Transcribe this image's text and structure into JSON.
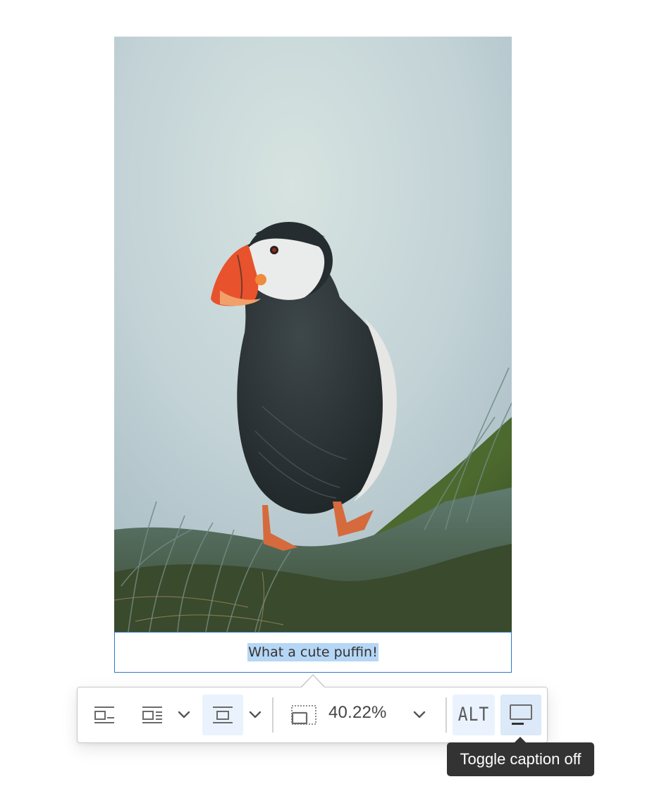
{
  "image": {
    "subject": "Puffin standing on grassy cliff"
  },
  "caption": {
    "text": "What a cute puffin!"
  },
  "toolbar": {
    "buttons": [
      {
        "name": "wrap-text-left",
        "icon": "image-inline-left-icon",
        "active": false
      },
      {
        "name": "wrap-text-right",
        "icon": "image-inline-right-icon",
        "active": false
      },
      {
        "name": "wrap-dropdown",
        "icon": "chevron-down-icon",
        "active": false
      },
      {
        "name": "break-text-centered",
        "icon": "image-centered-icon",
        "active": true
      },
      {
        "name": "break-dropdown",
        "icon": "chevron-down-icon",
        "active": false
      },
      {
        "name": "resize",
        "icon": "resize-image-icon",
        "active": false
      },
      {
        "name": "resize-dropdown",
        "icon": "chevron-down-icon",
        "active": false
      },
      {
        "name": "alt-text",
        "icon": "alt-text-icon",
        "active": false
      },
      {
        "name": "toggle-caption",
        "icon": "caption-icon",
        "active": true
      }
    ],
    "resize_value": "40.22%",
    "alt_label": "ALT"
  },
  "tooltip": {
    "text": "Toggle caption off"
  },
  "colors": {
    "accent": "#2b78c9",
    "selection": "#b6d6f5",
    "active_button": "#eaf3fd",
    "tooltip_bg": "#333333"
  }
}
